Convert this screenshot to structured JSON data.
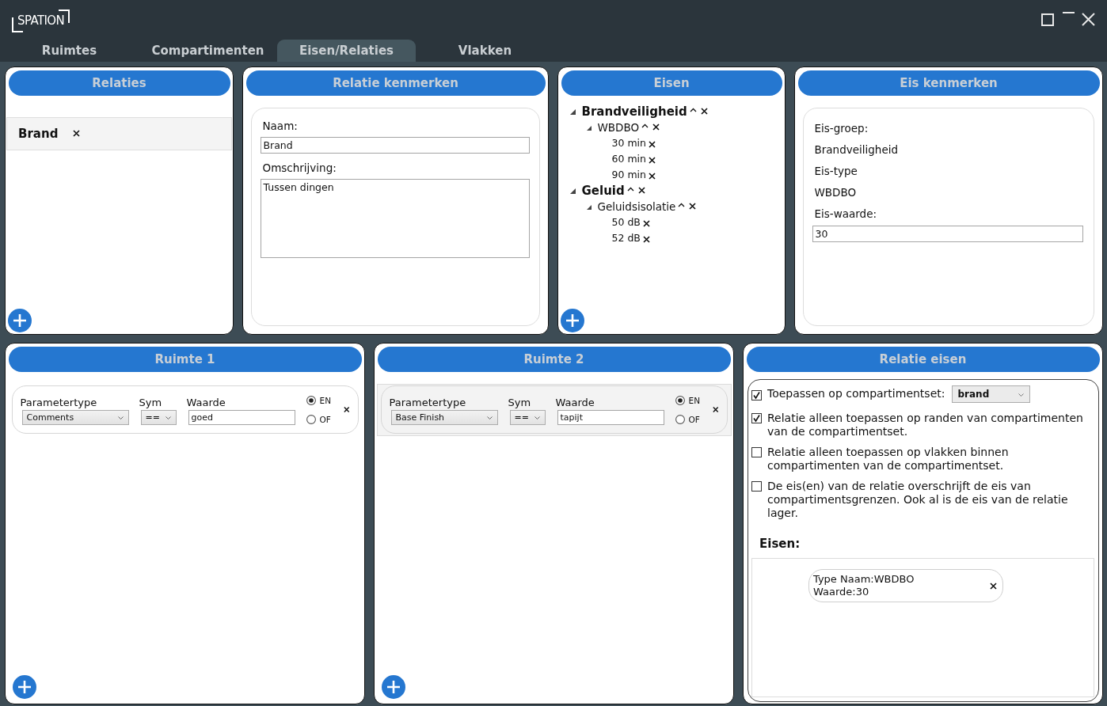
{
  "window": {
    "logo": "SPATION"
  },
  "tabs": [
    {
      "label": "Ruimtes",
      "selected": false
    },
    {
      "label": "Compartimenten",
      "selected": false
    },
    {
      "label": "Eisen/Relaties",
      "selected": true
    },
    {
      "label": "Vlakken",
      "selected": false
    }
  ],
  "relaties": {
    "title": "Relaties",
    "items": [
      {
        "label": "Brand",
        "selected": true
      }
    ]
  },
  "relatie_kenmerken": {
    "title": "Relatie kenmerken",
    "fields": [
      {
        "kind": "input",
        "label": "Naam:",
        "value": "Brand"
      },
      {
        "kind": "textarea",
        "label": "Omschrijving:",
        "value": "Tussen dingen"
      }
    ]
  },
  "eisen": {
    "title": "Eisen",
    "tree": [
      {
        "label": "Brandveiligheid",
        "expanded": true,
        "children": [
          {
            "label": "WBDBO",
            "expanded": true,
            "children": [
              {
                "label": "30 min"
              },
              {
                "label": "60 min"
              },
              {
                "label": "90 min"
              }
            ]
          }
        ]
      },
      {
        "label": "Geluid",
        "expanded": true,
        "children": [
          {
            "label": "Geluidsisolatie",
            "expanded": true,
            "children": [
              {
                "label": "50 dB"
              },
              {
                "label": "52 dB"
              }
            ]
          }
        ]
      }
    ]
  },
  "eis_kenmerken": {
    "title": "Eis kenmerken",
    "rows": [
      {
        "kind": "text",
        "text": "Eis-groep:"
      },
      {
        "kind": "text",
        "text": "Brandveiligheid"
      },
      {
        "kind": "text",
        "text": "Eis-type"
      },
      {
        "kind": "text",
        "text": "WBDBO"
      },
      {
        "kind": "text",
        "text": "Eis-waarde:"
      },
      {
        "kind": "input",
        "text": "30"
      }
    ]
  },
  "ruimtes": [
    {
      "title": "Ruimte 1",
      "conditions": [
        {
          "selected": false,
          "parametertype": {
            "label": "Parametertype",
            "value": "Comments"
          },
          "sym": {
            "label": "Sym",
            "value": "=="
          },
          "waarde": {
            "label": "Waarde",
            "value": "goed"
          },
          "logic": [
            {
              "label": "EN",
              "selected": true
            },
            {
              "label": "OF",
              "selected": false
            }
          ]
        }
      ]
    },
    {
      "title": "Ruimte 2",
      "conditions": [
        {
          "selected": true,
          "parametertype": {
            "label": "Parametertype",
            "value": "Base Finish"
          },
          "sym": {
            "label": "Sym",
            "value": "=="
          },
          "waarde": {
            "label": "Waarde",
            "value": "tapijt"
          },
          "logic": [
            {
              "label": "EN",
              "selected": true
            },
            {
              "label": "OF",
              "selected": false
            }
          ]
        }
      ]
    }
  ],
  "relatie_eisen": {
    "title": "Relatie eisen",
    "options": [
      {
        "label": "Toepassen op compartimentset:",
        "checked": true,
        "select": "brand"
      },
      {
        "label": "Relatie alleen toepassen op randen van compartimenten van de compartimentset.",
        "checked": true
      },
      {
        "label": "Relatie alleen toepassen op vlakken binnen compartimenten van de compartimentset.",
        "checked": false
      },
      {
        "label": "De eis(en) van de relatie overschrijft de eis van compartimentsgrenzen. Ook al is de eis van de relatie lager.",
        "checked": false
      }
    ],
    "eisen_label": "Eisen:",
    "eisen": [
      {
        "lines": [
          "Type Naam:WBDBO",
          "Waarde:30"
        ]
      }
    ]
  }
}
